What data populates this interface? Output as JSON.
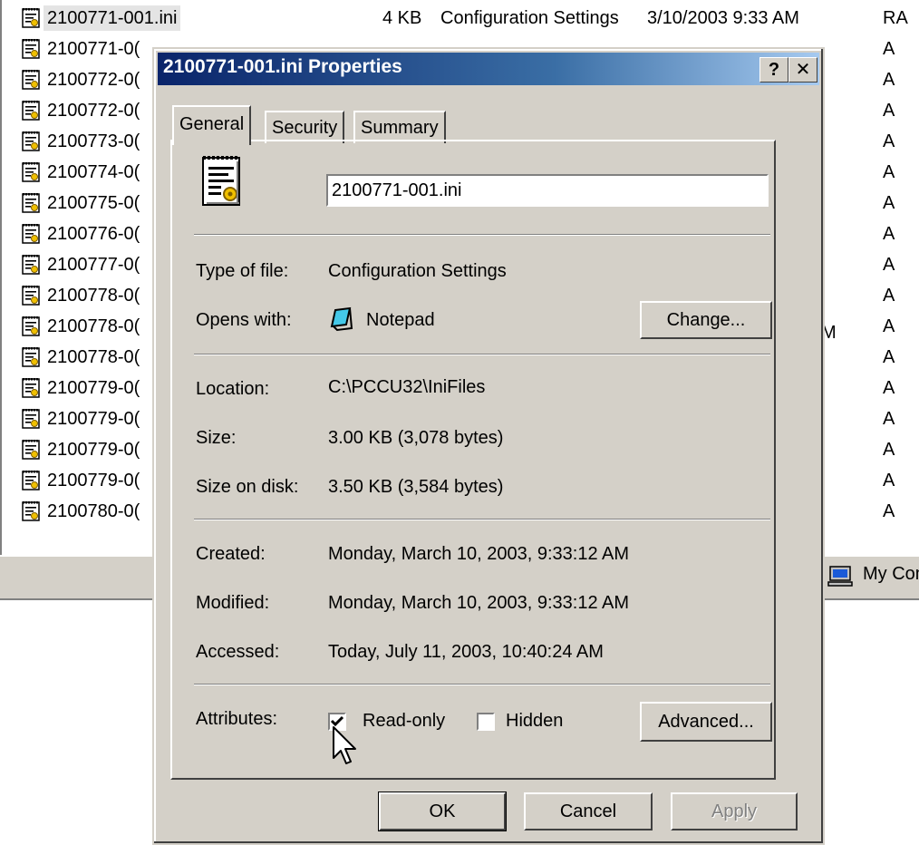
{
  "explorer": {
    "rows": [
      {
        "name": "2100771-001.ini",
        "size": "4 KB",
        "type": "Configuration Settings",
        "date": "3/10/2003 9:33 AM",
        "attr": "RA"
      },
      {
        "name": "2100771-0(",
        "attr": "A"
      },
      {
        "name": "2100772-0(",
        "attr": "A"
      },
      {
        "name": "2100772-0(",
        "attr": "A"
      },
      {
        "name": "2100773-0(",
        "attr": "A"
      },
      {
        "name": "2100774-0(",
        "attr": "A"
      },
      {
        "name": "2100775-0(",
        "attr": "A"
      },
      {
        "name": "2100776-0(",
        "attr": "A"
      },
      {
        "name": "2100777-0(",
        "attr": "A"
      },
      {
        "name": "2100778-0(",
        "attr": "A"
      },
      {
        "name": "2100778-0(",
        "attr": "A"
      },
      {
        "name": "2100778-0(",
        "attr": "A"
      },
      {
        "name": "2100779-0(",
        "attr": "A"
      },
      {
        "name": "2100779-0(",
        "attr": "A"
      },
      {
        "name": "2100779-0(",
        "attr": "A"
      },
      {
        "name": "2100779-0(",
        "attr": "A"
      },
      {
        "name": "2100780-0(",
        "attr": "A"
      }
    ],
    "truncated_m": "M",
    "status_text": "My Com"
  },
  "dialog": {
    "title": "2100771-001.ini Properties",
    "help_label": "?",
    "close_label": "✕",
    "tabs": [
      "General",
      "Security",
      "Summary"
    ],
    "file_name": "2100771-001.ini",
    "type_label": "Type of file:",
    "type_value": "Configuration Settings",
    "opens_label": "Opens with:",
    "opens_value": "Notepad",
    "change_label": "Change...",
    "location_label": "Location:",
    "location_value": "C:\\PCCU32\\IniFiles",
    "size_label": "Size:",
    "size_value": "3.00 KB (3,078 bytes)",
    "disk_label": "Size on disk:",
    "disk_value": "3.50 KB (3,584 bytes)",
    "created_label": "Created:",
    "created_value": "Monday, March 10, 2003, 9:33:12 AM",
    "modified_label": "Modified:",
    "modified_value": "Monday, March 10, 2003, 9:33:12 AM",
    "accessed_label": "Accessed:",
    "accessed_value": "Today, July 11, 2003, 10:40:24 AM",
    "attributes_label": "Attributes:",
    "readonly_label": "Read-only",
    "hidden_label": "Hidden",
    "advanced_label": "Advanced...",
    "ok_label": "OK",
    "cancel_label": "Cancel",
    "apply_label": "Apply"
  },
  "colors": {
    "title_bar": "#0a246a",
    "face": "#d4d0c8"
  }
}
